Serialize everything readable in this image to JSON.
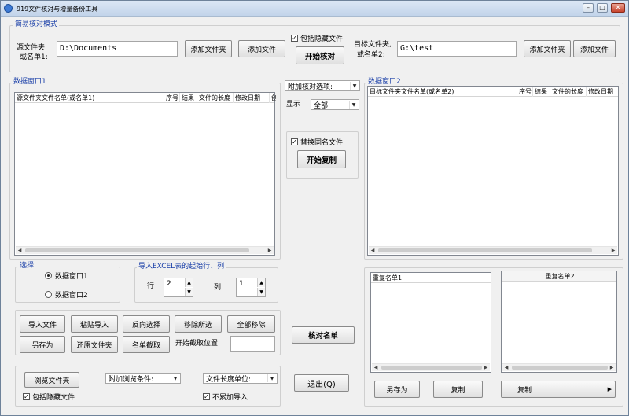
{
  "window": {
    "title": "919文件核对与增量备份工具"
  },
  "simple_mode": {
    "group_title": "简易核对模式",
    "source_label_1": "源文件夹,",
    "source_label_2": "或名单1:",
    "source_value": "D:\\Documents",
    "add_folder_1": "添加文件夹",
    "add_file_1": "添加文件",
    "include_hidden": "包括隐藏文件",
    "start_compare": "开始核对",
    "target_label_1": "目标文件夹,",
    "target_label_2": "或名单2:",
    "target_value": "G:\\test",
    "add_folder_2": "添加文件夹",
    "add_file_2": "添加文件"
  },
  "data_window_1": {
    "title": "数据窗口1",
    "columns": [
      "源文件夹文件名单(或名单1)",
      "序号",
      "结果",
      "文件的长度",
      "修改日期",
      "创"
    ]
  },
  "data_window_2": {
    "title": "数据窗口2",
    "columns": [
      "目标文件夹文件名单(或名单2)",
      "序号",
      "结果",
      "文件的长度",
      "修改日期"
    ]
  },
  "middle": {
    "extra_options": "附加核对选项:",
    "display_label": "显示",
    "display_value": "全部",
    "replace_same": "替换同名文件",
    "start_copy": "开始复制",
    "check_list": "核对名单",
    "exit": "退出(Q)"
  },
  "select_group": {
    "title": "选择",
    "opt1": "数据窗口1",
    "opt2": "数据窗口2"
  },
  "excel_group": {
    "title": "导入EXCEL表的起始行、列",
    "row_label": "行",
    "row_value": "2",
    "col_label": "列",
    "col_value": "1"
  },
  "actions": {
    "import_file": "导入文件",
    "paste_import": "粘贴导入",
    "invert": "反向选择",
    "remove_selected": "移除所选",
    "remove_all": "全部移除",
    "save_as": "另存为",
    "restore_folder": "还原文件夹",
    "cut_names": "名单截取",
    "cut_position": "开始截取位置"
  },
  "browse": {
    "browse_folder": "浏览文件夹",
    "extra_browse": "附加浏览条件:",
    "length_unit": "文件长度单位:",
    "include_hidden": "包括隐藏文件",
    "no_accumulate": "不累加导入"
  },
  "duplicates": {
    "dup1": "重复名单1",
    "dup2": "重复名单2",
    "save_as": "另存为",
    "copy1": "复制",
    "copy2": "复制"
  }
}
